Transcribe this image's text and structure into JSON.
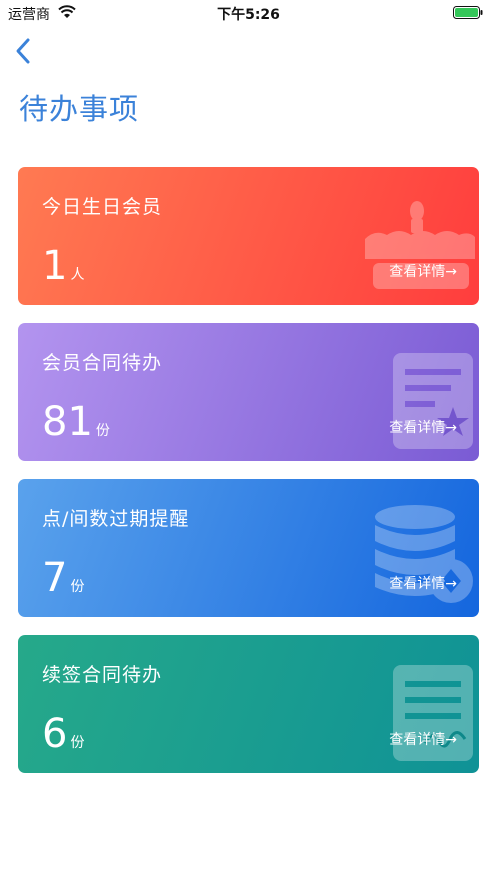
{
  "status_bar": {
    "carrier": "运营商",
    "time": "下午5:26"
  },
  "header": {
    "title": "待办事项"
  },
  "cards": [
    {
      "label": "今日生日会员",
      "count": "1",
      "unit": "人",
      "detail": "查看详情→",
      "icon": "birthday-cake-icon",
      "color": "#ff5a4a"
    },
    {
      "label": "会员合同待办",
      "count": "81",
      "unit": "份",
      "detail": "查看详情→",
      "icon": "contract-star-icon",
      "color": "#9a78e4"
    },
    {
      "label": "点/间数过期提醒",
      "count": "7",
      "unit": "份",
      "detail": "查看详情→",
      "icon": "coins-stack-icon",
      "color": "#3580e4"
    },
    {
      "label": "续签合同待办",
      "count": "6",
      "unit": "份",
      "detail": "查看详情→",
      "icon": "document-sign-icon",
      "color": "#1a9e90"
    }
  ]
}
